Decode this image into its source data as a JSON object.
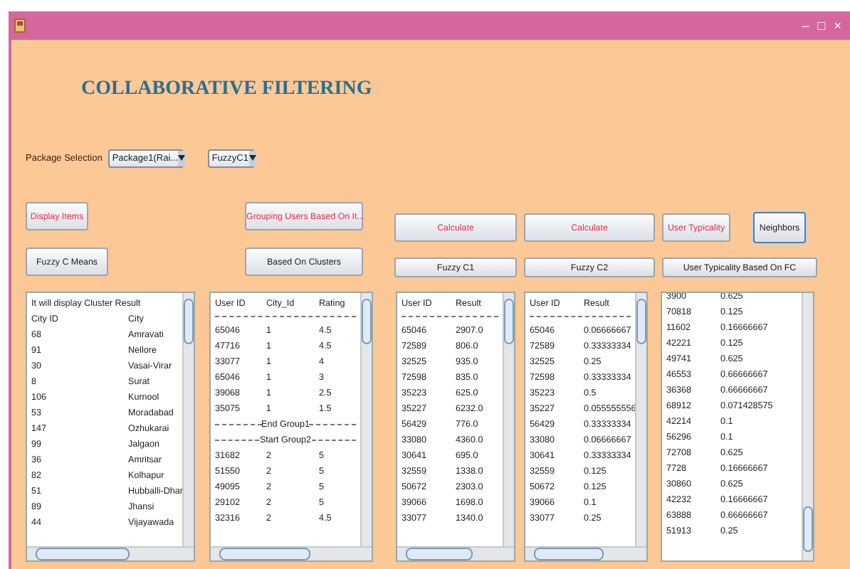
{
  "window": {
    "title": "COLLABORATIVE FILTERING",
    "controls": [
      "–",
      "□",
      "×"
    ]
  },
  "package_selection": {
    "label": "Package Selection",
    "package": "Package1(Rai...",
    "algorithm": "FuzzyC1"
  },
  "left_buttons": [
    [
      {
        "label": "Display Items",
        "highlighted": true
      },
      {
        "label": "Grouping Users Based On It...",
        "highlighted": true
      }
    ],
    [
      {
        "label": "Fuzzy C Means",
        "highlighted": false
      },
      {
        "label": "Based On Clusters",
        "highlighted": false
      }
    ]
  ],
  "right_buttons": [
    [
      {
        "label": "Calculate",
        "highlighted": true,
        "focused": false
      },
      {
        "label": "Calculate",
        "highlighted": true,
        "focused": false
      },
      {
        "label": "User Typicality",
        "highlighted": true,
        "focused": false
      },
      {
        "label": "Neighbors",
        "highlighted": false,
        "focused": true
      }
    ],
    [
      {
        "label": "Fuzzy C1",
        "highlighted": false,
        "focused": false
      },
      {
        "label": "Fuzzy C2",
        "highlighted": false,
        "focused": false
      },
      {
        "label": "User Typicality Based On FC",
        "highlighted": false,
        "focused": false
      }
    ]
  ],
  "cluster_panel": {
    "caption": "It will display Cluster Result",
    "columns": [
      "City ID",
      "City"
    ],
    "rows": [
      [
        "68",
        "Amravati"
      ],
      [
        "91",
        "Nellore"
      ],
      [
        "30",
        "Vasai-Virar"
      ],
      [
        "8",
        "Surat"
      ],
      [
        "106",
        "Kurnool"
      ],
      [
        "53",
        "Moradabad"
      ],
      [
        "147",
        "Ozhukarai"
      ],
      [
        "99",
        "Jalgaon"
      ],
      [
        "36",
        "Amritsar"
      ],
      [
        "82",
        "Kolhapur"
      ],
      [
        "51",
        "Hubballi-Dhar"
      ],
      [
        "89",
        "Jhansi"
      ],
      [
        "44",
        "Vijayawada"
      ]
    ]
  },
  "ratings_panel": {
    "columns": [
      "User ID",
      "City_Id",
      "Rating"
    ],
    "rows": [
      {
        "kind": "data",
        "cells": [
          "65046",
          "1",
          "4.5"
        ]
      },
      {
        "kind": "data",
        "cells": [
          "47716",
          "1",
          "4.5"
        ]
      },
      {
        "kind": "data",
        "cells": [
          "33077",
          "1",
          "4"
        ]
      },
      {
        "kind": "data",
        "cells": [
          "65046",
          "1",
          "3"
        ]
      },
      {
        "kind": "data",
        "cells": [
          "39068",
          "1",
          "2.5"
        ]
      },
      {
        "kind": "data",
        "cells": [
          "35075",
          "1",
          "1.5"
        ]
      },
      {
        "kind": "separator",
        "cells": [
          "End Group1"
        ]
      },
      {
        "kind": "separator",
        "cells": [
          "Start Group2"
        ]
      },
      {
        "kind": "data",
        "cells": [
          "31682",
          "2",
          "5"
        ]
      },
      {
        "kind": "data",
        "cells": [
          "51550",
          "2",
          "5"
        ]
      },
      {
        "kind": "data",
        "cells": [
          "49095",
          "2",
          "5"
        ]
      },
      {
        "kind": "data",
        "cells": [
          "29102",
          "2",
          "5"
        ]
      },
      {
        "kind": "data",
        "cells": [
          "32316",
          "2",
          "4.5"
        ]
      }
    ]
  },
  "fuzzy_c1_panel": {
    "columns": [
      "User ID",
      "Result"
    ],
    "rows": [
      [
        "65046",
        "2907.0"
      ],
      [
        "72589",
        "806.0"
      ],
      [
        "32525",
        "935.0"
      ],
      [
        "72598",
        "835.0"
      ],
      [
        "35223",
        "625.0"
      ],
      [
        "35227",
        "6232.0"
      ],
      [
        "56429",
        "776.0"
      ],
      [
        "33080",
        "4360.0"
      ],
      [
        "30641",
        "695.0"
      ],
      [
        "32559",
        "1338.0"
      ],
      [
        "50672",
        "2303.0"
      ],
      [
        "39066",
        "1698.0"
      ],
      [
        "33077",
        "1340.0"
      ]
    ]
  },
  "fuzzy_c2_panel": {
    "columns": [
      "User ID",
      "Result"
    ],
    "rows": [
      [
        "65046",
        "0.06666667"
      ],
      [
        "72589",
        "0.33333334"
      ],
      [
        "32525",
        "0.25"
      ],
      [
        "72598",
        "0.33333334"
      ],
      [
        "35223",
        "0.5"
      ],
      [
        "35227",
        "0.055555556"
      ],
      [
        "56429",
        "0.33333334"
      ],
      [
        "33080",
        "0.06666667"
      ],
      [
        "30641",
        "0.33333334"
      ],
      [
        "32559",
        "0.125"
      ],
      [
        "50672",
        "0.125"
      ],
      [
        "39066",
        "0.1"
      ],
      [
        "33077",
        "0.25"
      ]
    ]
  },
  "typicality_panel": {
    "rows": [
      [
        "3900",
        "0.625"
      ],
      [
        "70818",
        "0.125"
      ],
      [
        "11602",
        "0.16666667"
      ],
      [
        "42221",
        "0.125"
      ],
      [
        "49741",
        "0.625"
      ],
      [
        "46553",
        "0.66666667"
      ],
      [
        "36368",
        "0.66666667"
      ],
      [
        "68912",
        "0.071428575"
      ],
      [
        "42214",
        "0.1"
      ],
      [
        "56296",
        "0.1"
      ],
      [
        "72708",
        "0.625"
      ],
      [
        "7728",
        "0.16666667"
      ],
      [
        "30860",
        "0.625"
      ],
      [
        "42232",
        "0.16666667"
      ],
      [
        "63888",
        "0.66666667"
      ],
      [
        "51913",
        "0.25"
      ]
    ]
  }
}
